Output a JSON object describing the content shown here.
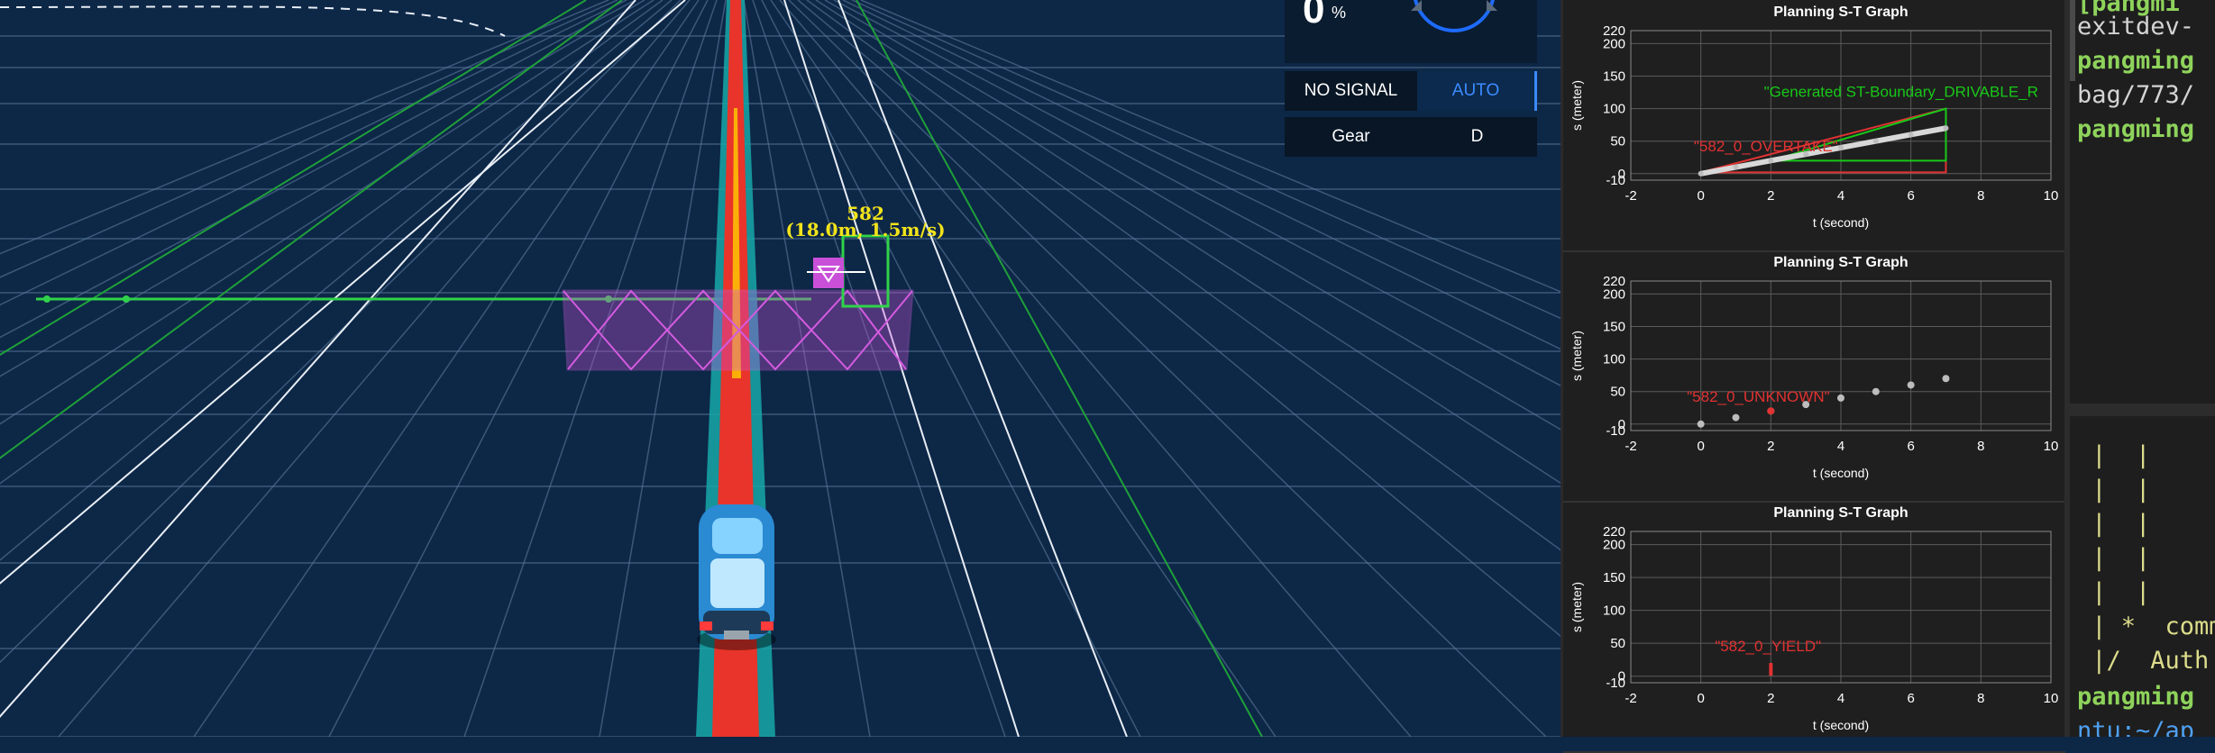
{
  "scene": {
    "obstacle_id": "582",
    "obstacle_info": "(18.0m, 1.5m/s)"
  },
  "status": {
    "speed_value": "0",
    "speed_unit": "%",
    "signal": "NO SIGNAL",
    "mode": "AUTO",
    "gear_label": "Gear",
    "gear_value": "D"
  },
  "colors": {
    "background": "#0d2747",
    "planning_red": "#e8342a",
    "boundary_magenta": "#c94fd8",
    "reference_green": "#2fd24a",
    "auto_blue": "#3c8bff"
  },
  "chart_data": [
    {
      "type": "scatter",
      "title": "Planning S-T Graph",
      "xlabel": "t (second)",
      "ylabel": "s (meter)",
      "x_ticks": [
        "-2",
        "0",
        "2",
        "4",
        "6",
        "8",
        "10"
      ],
      "y_ticks": [
        "-10",
        "0",
        "50",
        "100",
        "150",
        "200",
        "220"
      ],
      "xlim": [
        -2,
        10
      ],
      "ylim": [
        -10,
        220
      ],
      "grid": true,
      "annotations": [
        "\"582_0_OVERTAKE\"",
        "\"Generated ST-Boundary_DRIVABLE_R"
      ],
      "series": [
        {
          "points": [
            [
              0,
              0
            ],
            [
              1,
              10
            ],
            [
              2,
              20
            ],
            [
              3,
              30
            ],
            [
              4,
              40
            ],
            [
              5,
              50
            ],
            [
              6,
              60
            ],
            [
              7,
              70
            ]
          ]
        }
      ],
      "boundaries": [
        {
          "color": "#e23232",
          "polygon": [
            [
              0,
              2
            ],
            [
              7,
              2
            ],
            [
              7,
              100
            ],
            [
              0,
              2
            ]
          ]
        },
        {
          "color": "#18c818",
          "polygon": [
            [
              2,
              20
            ],
            [
              7,
              20
            ],
            [
              7,
              100
            ],
            [
              2,
              20
            ]
          ]
        }
      ]
    },
    {
      "type": "scatter",
      "title": "Planning S-T Graph",
      "xlabel": "t (second)",
      "ylabel": "s (meter)",
      "x_ticks": [
        "-2",
        "0",
        "2",
        "4",
        "6",
        "8",
        "10"
      ],
      "y_ticks": [
        "-10",
        "0",
        "50",
        "100",
        "150",
        "200",
        "220"
      ],
      "xlim": [
        -2,
        10
      ],
      "ylim": [
        -10,
        220
      ],
      "grid": true,
      "annotations": [
        "\"582_0_UNKNOWN\""
      ],
      "series": [
        {
          "points": [
            [
              0,
              0
            ],
            [
              1,
              10
            ],
            [
              2,
              20
            ],
            [
              3,
              30
            ],
            [
              4,
              40
            ],
            [
              5,
              50
            ],
            [
              6,
              60
            ],
            [
              7,
              70
            ]
          ]
        }
      ]
    },
    {
      "type": "scatter",
      "title": "Planning S-T Graph",
      "xlabel": "t (second)",
      "ylabel": "s (meter)",
      "x_ticks": [
        "-2",
        "0",
        "2",
        "4",
        "6",
        "8",
        "10"
      ],
      "y_ticks": [
        "-10",
        "0",
        "50",
        "100",
        "150",
        "200",
        "220"
      ],
      "xlim": [
        -2,
        10
      ],
      "ylim": [
        -10,
        220
      ],
      "grid": true,
      "annotations": [
        "\"582_0_YIELD\""
      ],
      "series": []
    }
  ],
  "code": {
    "lines": [
      {
        "text": "[pangmi",
        "cls": "green"
      },
      {
        "text": "exitdev-",
        "cls": "plain"
      },
      {
        "text": "pangming",
        "cls": "green"
      },
      {
        "text": "bag/773/",
        "cls": "plain"
      },
      {
        "text": "pangming",
        "cls": "green"
      },
      {
        "text": " |  |",
        "cls": "yellow"
      },
      {
        "text": " |  |",
        "cls": "yellow"
      },
      {
        "text": " |  |",
        "cls": "yellow"
      },
      {
        "text": " |  |",
        "cls": "yellow"
      },
      {
        "text": " |  |",
        "cls": "yellow"
      },
      {
        "text": " | *  comm",
        "cls": "yellow"
      },
      {
        "text": " |/  Auth",
        "cls": "yellow"
      },
      {
        "text": "pangming",
        "cls": "green"
      },
      {
        "text": "ntu:~/ap",
        "cls": "blue"
      }
    ]
  }
}
